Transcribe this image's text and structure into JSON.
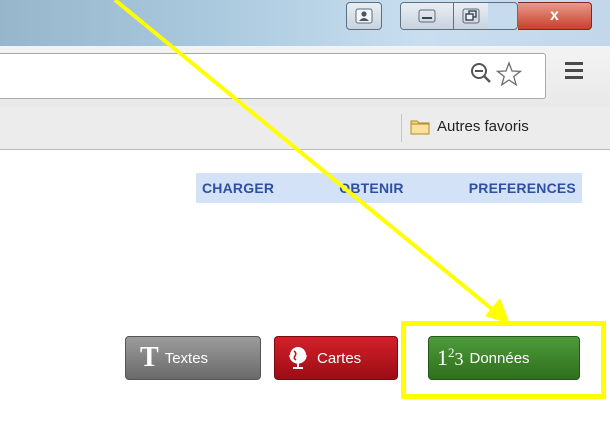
{
  "window": {
    "controls": {
      "user_icon": "user-icon",
      "minimize_icon": "minimize-icon",
      "maximize_icon": "restore-icon",
      "close_label": "x"
    }
  },
  "toolbar": {
    "zoom_icon": "zoom-out-icon",
    "star_icon": "bookmark-star-icon",
    "menu_icon": "hamburger-menu-icon"
  },
  "bookmarks": {
    "other_folder_label": "Autres favoris",
    "folder_icon": "folder-icon"
  },
  "nav": {
    "items": [
      "CHARGER",
      "OBTENIR",
      "PREFERENCES"
    ]
  },
  "buttons": {
    "textes": {
      "glyph": "T",
      "label": "Textes",
      "color": "#7d7d7d"
    },
    "cartes": {
      "label": "Cartes",
      "icon": "globe-icon",
      "color": "#c1121c"
    },
    "donnees": {
      "glyph_base": "1",
      "glyph_sup": "2",
      "glyph_sub": "3",
      "label": "Données",
      "color": "#3f8a2a"
    }
  },
  "annotation": {
    "color": "#ffff00",
    "type": "arrow-and-highlight-box"
  }
}
